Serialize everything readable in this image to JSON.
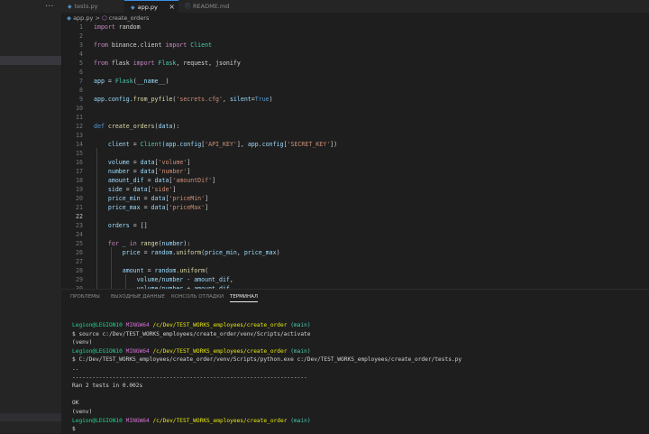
{
  "sidebar": {
    "more_label": "···"
  },
  "tabs": [
    {
      "icon": "◆",
      "label": "tests.py",
      "active": false
    },
    {
      "icon": "◆",
      "label": "app.py",
      "active": true,
      "close": "×"
    },
    {
      "icon": "ⓘ",
      "label": "README.md",
      "active": false
    }
  ],
  "breadcrumb": {
    "file": "app.py",
    "sep": ">",
    "func_icon": "⬡",
    "func": "create_orders"
  },
  "editor": {
    "lines": [
      {
        "n": "1",
        "t": [
          [
            "k",
            "import"
          ],
          [
            "p",
            " random"
          ]
        ]
      },
      {
        "n": "2",
        "t": []
      },
      {
        "n": "3",
        "t": [
          [
            "k",
            "from"
          ],
          [
            "p",
            " binance.client "
          ],
          [
            "k",
            "import"
          ],
          [
            "p",
            " "
          ],
          [
            "c",
            "Client"
          ]
        ]
      },
      {
        "n": "4",
        "t": []
      },
      {
        "n": "5",
        "t": [
          [
            "k",
            "from"
          ],
          [
            "p",
            " flask "
          ],
          [
            "k",
            "import"
          ],
          [
            "p",
            " "
          ],
          [
            "c",
            "Flask"
          ],
          [
            "p",
            ", request, jsonify"
          ]
        ]
      },
      {
        "n": "6",
        "t": []
      },
      {
        "n": "7",
        "t": [
          [
            "v",
            "app"
          ],
          [
            "p",
            " = "
          ],
          [
            "c",
            "Flask"
          ],
          [
            "p",
            "("
          ],
          [
            "v",
            "__name__"
          ],
          [
            "p",
            ")"
          ]
        ]
      },
      {
        "n": "8",
        "t": []
      },
      {
        "n": "9",
        "t": [
          [
            "v",
            "app"
          ],
          [
            "p",
            "."
          ],
          [
            "v",
            "config"
          ],
          [
            "p",
            "."
          ],
          [
            "f",
            "from_pyfile"
          ],
          [
            "p",
            "("
          ],
          [
            "s",
            "'secrets.cfg'"
          ],
          [
            "p",
            ", "
          ],
          [
            "v",
            "silent"
          ],
          [
            "p",
            "="
          ],
          [
            "d",
            "True"
          ],
          [
            "p",
            ")"
          ]
        ]
      },
      {
        "n": "10",
        "t": []
      },
      {
        "n": "11",
        "t": []
      },
      {
        "n": "12",
        "t": [
          [
            "d",
            "def"
          ],
          [
            "p",
            " "
          ],
          [
            "f",
            "create_orders"
          ],
          [
            "p",
            "("
          ],
          [
            "v",
            "data"
          ],
          [
            "p",
            "):"
          ]
        ]
      },
      {
        "n": "13",
        "t": []
      },
      {
        "n": "14",
        "t": [
          [
            "p",
            "    "
          ],
          [
            "v",
            "client"
          ],
          [
            "p",
            " = "
          ],
          [
            "c",
            "Client"
          ],
          [
            "p",
            "("
          ],
          [
            "v",
            "app"
          ],
          [
            "p",
            "."
          ],
          [
            "v",
            "config"
          ],
          [
            "p",
            "["
          ],
          [
            "s",
            "'API_KEY'"
          ],
          [
            "p",
            "], "
          ],
          [
            "v",
            "app"
          ],
          [
            "p",
            "."
          ],
          [
            "v",
            "config"
          ],
          [
            "p",
            "["
          ],
          [
            "s",
            "'SECRET_KEY'"
          ],
          [
            "p",
            "])"
          ]
        ]
      },
      {
        "n": "15",
        "t": []
      },
      {
        "n": "16",
        "t": [
          [
            "p",
            "    "
          ],
          [
            "v",
            "volume"
          ],
          [
            "p",
            " = "
          ],
          [
            "v",
            "data"
          ],
          [
            "p",
            "["
          ],
          [
            "s",
            "'volume'"
          ],
          [
            "p",
            "]"
          ]
        ]
      },
      {
        "n": "17",
        "t": [
          [
            "p",
            "    "
          ],
          [
            "v",
            "number"
          ],
          [
            "p",
            " = "
          ],
          [
            "v",
            "data"
          ],
          [
            "p",
            "["
          ],
          [
            "s",
            "'number'"
          ],
          [
            "p",
            "]"
          ]
        ]
      },
      {
        "n": "18",
        "t": [
          [
            "p",
            "    "
          ],
          [
            "v",
            "amount_dif"
          ],
          [
            "p",
            " = "
          ],
          [
            "v",
            "data"
          ],
          [
            "p",
            "["
          ],
          [
            "s",
            "'amountDif'"
          ],
          [
            "p",
            "]"
          ]
        ]
      },
      {
        "n": "19",
        "t": [
          [
            "p",
            "    "
          ],
          [
            "v",
            "side"
          ],
          [
            "p",
            " = "
          ],
          [
            "v",
            "data"
          ],
          [
            "p",
            "["
          ],
          [
            "s",
            "'side'"
          ],
          [
            "p",
            "]"
          ]
        ]
      },
      {
        "n": "20",
        "t": [
          [
            "p",
            "    "
          ],
          [
            "v",
            "price_min"
          ],
          [
            "p",
            " = "
          ],
          [
            "v",
            "data"
          ],
          [
            "p",
            "["
          ],
          [
            "s",
            "'priceMin'"
          ],
          [
            "p",
            "]"
          ]
        ]
      },
      {
        "n": "21",
        "t": [
          [
            "p",
            "    "
          ],
          [
            "v",
            "price_max"
          ],
          [
            "p",
            " = "
          ],
          [
            "v",
            "data"
          ],
          [
            "p",
            "["
          ],
          [
            "s",
            "'priceMax'"
          ],
          [
            "p",
            "]"
          ]
        ]
      },
      {
        "n": "22",
        "t": [],
        "current": true
      },
      {
        "n": "23",
        "t": [
          [
            "p",
            "    "
          ],
          [
            "v",
            "orders"
          ],
          [
            "p",
            " = []"
          ]
        ]
      },
      {
        "n": "24",
        "t": []
      },
      {
        "n": "25",
        "t": [
          [
            "p",
            "    "
          ],
          [
            "k",
            "for"
          ],
          [
            "p",
            " "
          ],
          [
            "v",
            "_"
          ],
          [
            "p",
            " "
          ],
          [
            "k",
            "in"
          ],
          [
            "p",
            " "
          ],
          [
            "f",
            "range"
          ],
          [
            "p",
            "("
          ],
          [
            "v",
            "number"
          ],
          [
            "p",
            "):"
          ]
        ]
      },
      {
        "n": "26",
        "t": [
          [
            "p",
            "        "
          ],
          [
            "v",
            "price"
          ],
          [
            "p",
            " = "
          ],
          [
            "v",
            "random"
          ],
          [
            "p",
            "."
          ],
          [
            "f",
            "uniform"
          ],
          [
            "p",
            "("
          ],
          [
            "v",
            "price_min"
          ],
          [
            "p",
            ", "
          ],
          [
            "v",
            "price_max"
          ],
          [
            "p",
            ")"
          ]
        ]
      },
      {
        "n": "27",
        "t": []
      },
      {
        "n": "28",
        "t": [
          [
            "p",
            "        "
          ],
          [
            "v",
            "amount"
          ],
          [
            "p",
            " = "
          ],
          [
            "v",
            "random"
          ],
          [
            "p",
            "."
          ],
          [
            "f",
            "uniform"
          ],
          [
            "p",
            "("
          ]
        ]
      },
      {
        "n": "29",
        "t": [
          [
            "p",
            "            "
          ],
          [
            "v",
            "volume"
          ],
          [
            "p",
            "/"
          ],
          [
            "v",
            "number"
          ],
          [
            "p",
            " - "
          ],
          [
            "v",
            "amount_dif"
          ],
          [
            "p",
            ","
          ]
        ]
      },
      {
        "n": "30",
        "t": [
          [
            "p",
            "            "
          ],
          [
            "v",
            "volume"
          ],
          [
            "p",
            "/"
          ],
          [
            "v",
            "number"
          ],
          [
            "p",
            " + "
          ],
          [
            "v",
            "amount_dif"
          ]
        ]
      }
    ]
  },
  "panel": {
    "tabs": [
      {
        "label": "ПРОБЛЕМЫ",
        "active": false
      },
      {
        "label": "ВЫХОДНЫЕ ДАННЫЕ",
        "active": false
      },
      {
        "label": "КОНСОЛЬ ОТЛАДКИ",
        "active": false
      },
      {
        "label": "ТЕРМИНАЛ",
        "active": true
      }
    ],
    "terminal": [
      [
        [
          "g",
          "Legion@LEGION10"
        ],
        [
          "p",
          " "
        ],
        [
          "m",
          "MINGW64"
        ],
        [
          "p",
          " "
        ],
        [
          "y",
          "/c/Dev/TEST_WORKS_employees/create_order"
        ],
        [
          "p",
          " "
        ],
        [
          "c",
          "(main)"
        ]
      ],
      [
        [
          "p",
          "$ source c:/Dev/TEST_WORKS_employees/create_order/venv/Scripts/activate"
        ]
      ],
      [
        [
          "p",
          "(venv)"
        ]
      ],
      [
        [
          "g",
          "Legion@LEGION10"
        ],
        [
          "p",
          " "
        ],
        [
          "m",
          "MINGW64"
        ],
        [
          "p",
          " "
        ],
        [
          "y",
          "/c/Dev/TEST_WORKS_employees/create_order"
        ],
        [
          "p",
          " "
        ],
        [
          "c",
          "(main)"
        ]
      ],
      [
        [
          "p",
          "$ C:/Dev/TEST_WORKS_employees/create_order/venv/Scripts/python.exe c:/Dev/TEST_WORKS_employees/create_order/tests.py"
        ]
      ],
      [
        [
          "p",
          ".."
        ]
      ],
      [
        [
          "p",
          "----------------------------------------------------------------------"
        ]
      ],
      [
        [
          "p",
          "Ran 2 tests in 0.002s"
        ]
      ],
      [
        [
          "p",
          ""
        ]
      ],
      [
        [
          "p",
          "OK"
        ]
      ],
      [
        [
          "p",
          "(venv)"
        ]
      ],
      [
        [
          "g",
          "Legion@LEGION10"
        ],
        [
          "p",
          " "
        ],
        [
          "m",
          "MINGW64"
        ],
        [
          "p",
          " "
        ],
        [
          "y",
          "/c/Dev/TEST_WORKS_employees/create_order"
        ],
        [
          "p",
          " "
        ],
        [
          "c",
          "(main)"
        ]
      ],
      [
        [
          "p",
          "$"
        ]
      ]
    ]
  }
}
